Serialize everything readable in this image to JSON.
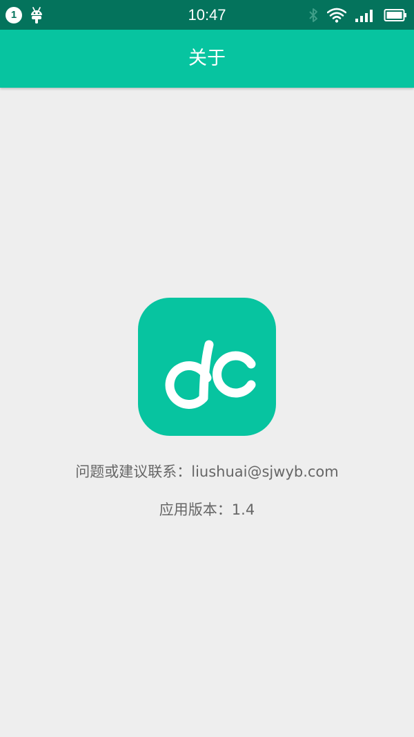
{
  "status_bar": {
    "notification_count": "1",
    "time": "10:47",
    "icons": [
      "notification-badge",
      "android-debug-icon",
      "bluetooth-icon",
      "wifi-icon",
      "signal-icon",
      "battery-icon"
    ],
    "background_color": "#04735c"
  },
  "app_bar": {
    "title": "关于",
    "background_color": "#07c4a0"
  },
  "about": {
    "logo_icon": "dc-logo-icon",
    "logo_color": "#07c4a0",
    "contact_label": "问题或建议联系：",
    "contact_email": "liushuai@sjwyb.com",
    "version_label": "应用版本：",
    "version_value": "1.4"
  }
}
